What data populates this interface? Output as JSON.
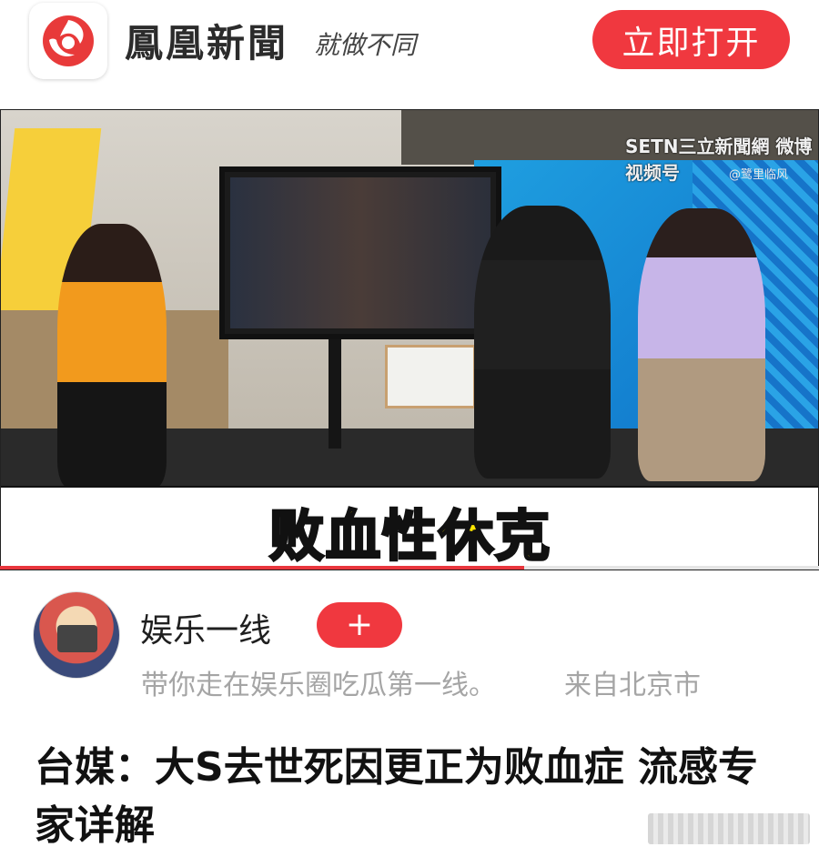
{
  "header": {
    "brand": "鳳凰新聞",
    "slogan": "就做不同",
    "open_button": "立即打开",
    "logo_icon": "phoenix-logo-icon",
    "accent_color": "#f0383f"
  },
  "video": {
    "watermark": "SETN三立新聞網 微博视频号",
    "watermark_handle": "@鹭里临风",
    "caption": "败血性休克",
    "caption_color": "#ffe600",
    "progress_fraction": 0.64
  },
  "author": {
    "name": "娱乐一线",
    "follow_label": "+",
    "description": "带你走在娱乐圈吃瓜第一线。",
    "location": "来自北京市"
  },
  "article": {
    "headline": "台媒：大S去世死因更正为败血症 流感专家详解"
  }
}
